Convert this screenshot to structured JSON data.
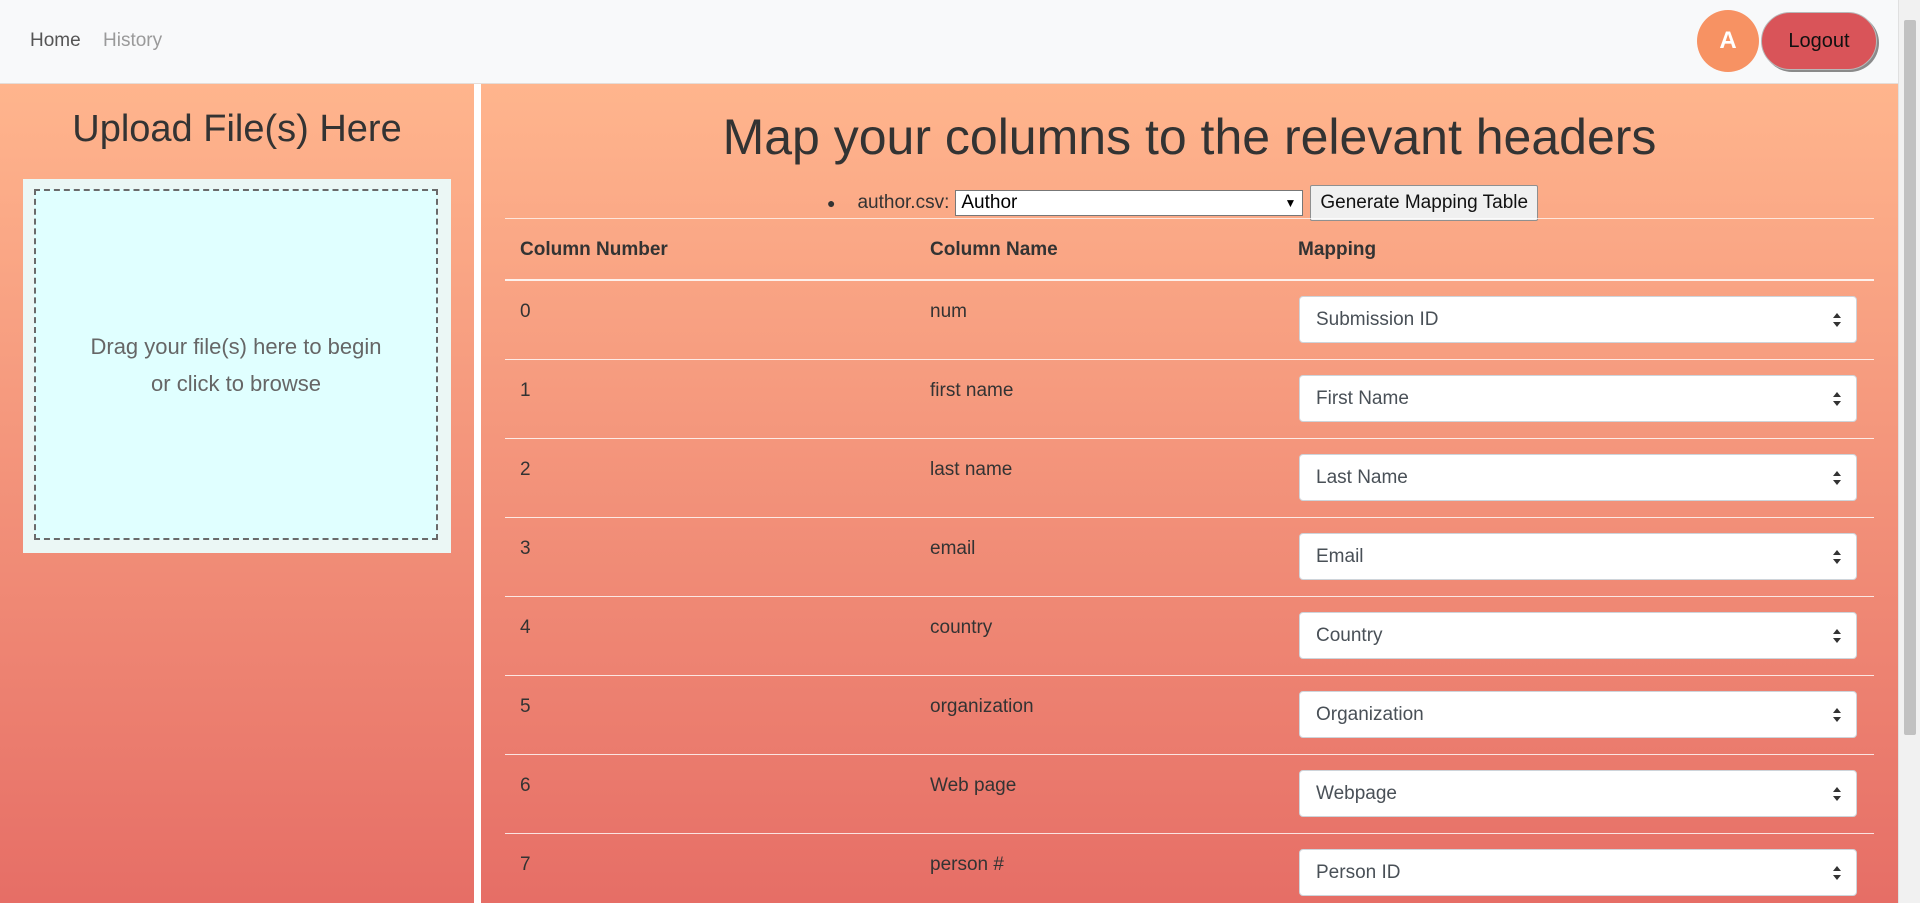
{
  "nav": {
    "home": "Home",
    "history": "History",
    "avatar_initial": "A",
    "logout": "Logout"
  },
  "upload": {
    "title": "Upload File(s) Here",
    "drop_line1": "Drag your file(s) here to begin",
    "drop_line2": "or click to browse"
  },
  "mapping": {
    "title": "Map your columns to the relevant headers",
    "file_label": "author.csv:",
    "file_type_selected": "Author",
    "generate_button": "Generate Mapping Table",
    "headers": [
      "Column Number",
      "Column Name",
      "Mapping"
    ],
    "rows": [
      {
        "num": "0",
        "name": "num",
        "mapping": "Submission ID"
      },
      {
        "num": "1",
        "name": "first name",
        "mapping": "First Name"
      },
      {
        "num": "2",
        "name": "last name",
        "mapping": "Last Name"
      },
      {
        "num": "3",
        "name": "email",
        "mapping": "Email"
      },
      {
        "num": "4",
        "name": "country",
        "mapping": "Country"
      },
      {
        "num": "5",
        "name": "organization",
        "mapping": "Organization"
      },
      {
        "num": "6",
        "name": "Web page",
        "mapping": "Webpage"
      },
      {
        "num": "7",
        "name": "person #",
        "mapping": "Person ID"
      }
    ]
  },
  "colors": {
    "gradient_top": "#ffb58d",
    "gradient_bottom": "#e66e66",
    "avatar": "#f79263",
    "logout": "#d95459",
    "dropzone": "#e0ffff"
  }
}
